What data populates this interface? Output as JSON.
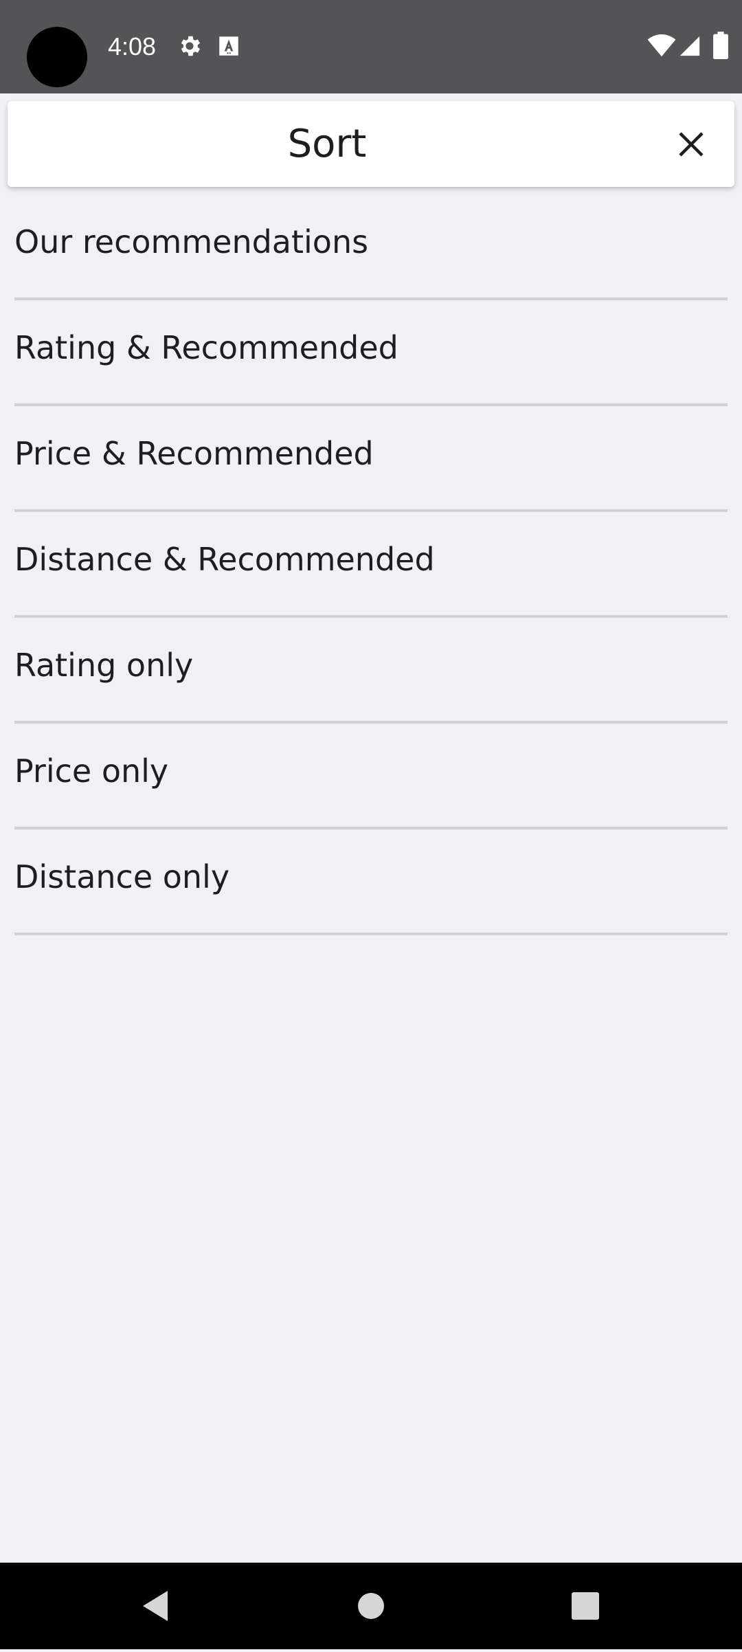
{
  "status_bar": {
    "time": "4:08",
    "icons": [
      "gear-icon",
      "keyboard-a-icon",
      "wifi-icon",
      "cell-signal-icon",
      "battery-icon"
    ]
  },
  "header": {
    "title": "Sort",
    "close_icon": "close-icon"
  },
  "sort_options": [
    {
      "label": "Our recommendations"
    },
    {
      "label": "Rating & Recommended"
    },
    {
      "label": "Price & Recommended"
    },
    {
      "label": "Distance & Recommended"
    },
    {
      "label": "Rating only"
    },
    {
      "label": "Price only"
    },
    {
      "label": "Distance only"
    }
  ],
  "nav_bar": {
    "icons": [
      "back-icon",
      "home-icon",
      "recents-icon"
    ]
  },
  "colors": {
    "status_bar_bg": "#545456",
    "page_bg": "#f1f0f5",
    "header_bg": "#ffffff",
    "text": "#1e1e1e",
    "divider": "#d2d1d6",
    "nav_bar_bg": "#000000"
  }
}
